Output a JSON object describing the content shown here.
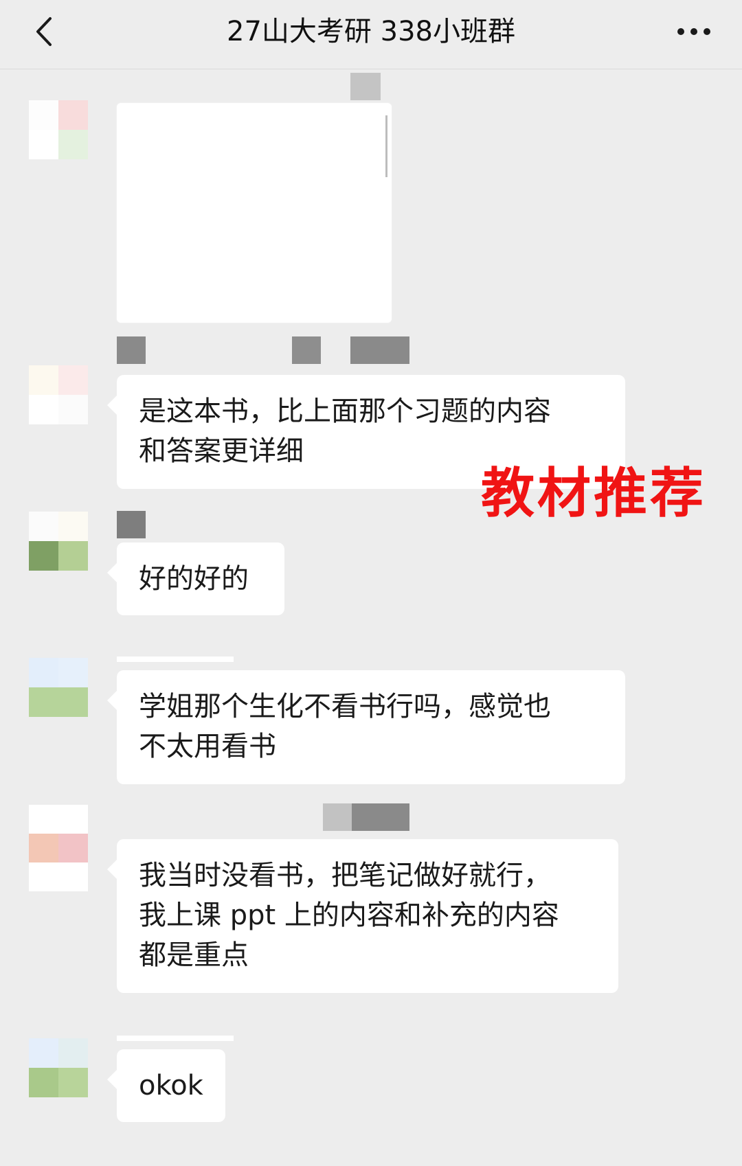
{
  "header": {
    "title": "27山大考研 338小班群",
    "back_icon": "chevron-left-icon",
    "more_icon": "more-horizontal-icon"
  },
  "messages": [
    {
      "type": "image"
    },
    {
      "type": "text",
      "text_lines": [
        "是这本书，比上面那个习题的内容",
        "和答案更详细"
      ]
    },
    {
      "type": "text",
      "text_lines": [
        "好的好的"
      ]
    },
    {
      "type": "text",
      "text_lines": [
        "学姐那个生化不看书行吗，感觉也",
        "不太用看书"
      ]
    },
    {
      "type": "text",
      "text_lines": [
        "我当时没看书，把笔记做好就行，",
        "我上课 ppt 上的内容和补充的内容",
        "都是重点"
      ]
    },
    {
      "type": "text",
      "text_lines": [
        "okok"
      ]
    }
  ],
  "overlay": {
    "text": "教材推荐",
    "color": "#f01414"
  },
  "colors": {
    "background": "#ededed",
    "bubble": "#ffffff",
    "text": "#1a1a1a"
  }
}
